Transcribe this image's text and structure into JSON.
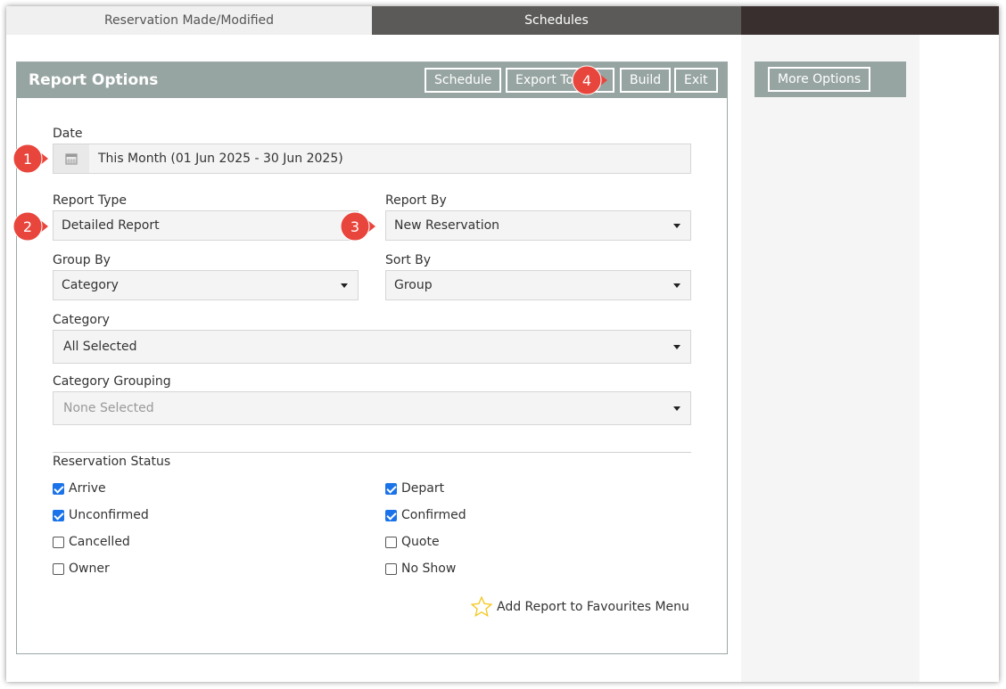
{
  "tabs": [
    {
      "label": "Reservation Made/Modified"
    },
    {
      "label": "Schedules"
    }
  ],
  "panel": {
    "title": "Report Options",
    "buttons": {
      "schedule": "Schedule",
      "export": "Export To",
      "build": "Build",
      "exit": "Exit"
    }
  },
  "more_options": "More Options",
  "form": {
    "date": {
      "label": "Date",
      "value": "This Month (01 Jun 2025 - 30 Jun 2025)"
    },
    "report_type": {
      "label": "Report Type",
      "value": "Detailed Report"
    },
    "report_by": {
      "label": "Report By",
      "value": "New Reservation"
    },
    "group_by": {
      "label": "Group By",
      "value": "Category"
    },
    "sort_by": {
      "label": "Sort By",
      "value": "Group"
    },
    "category": {
      "label": "Category",
      "value": "All Selected"
    },
    "category_grouping": {
      "label": "Category Grouping",
      "value": "None Selected"
    }
  },
  "reservation_status": {
    "label": "Reservation Status",
    "items": [
      {
        "label": "Arrive",
        "checked": true
      },
      {
        "label": "Depart",
        "checked": true
      },
      {
        "label": "Unconfirmed",
        "checked": true
      },
      {
        "label": "Confirmed",
        "checked": true
      },
      {
        "label": "Cancelled",
        "checked": false
      },
      {
        "label": "Quote",
        "checked": false
      },
      {
        "label": "Owner",
        "checked": false
      },
      {
        "label": "No Show",
        "checked": false
      }
    ]
  },
  "favourites": {
    "label": "Add Report to Favourites Menu",
    "icon": "star-icon"
  },
  "markers": [
    {
      "number": "1"
    },
    {
      "number": "2"
    },
    {
      "number": "3"
    },
    {
      "number": "4"
    }
  ],
  "colors": {
    "header": "#97a5a2",
    "marker": "#e8453c",
    "checkbox": "#1a73e8",
    "schedules_tab": "#5c5a59"
  }
}
